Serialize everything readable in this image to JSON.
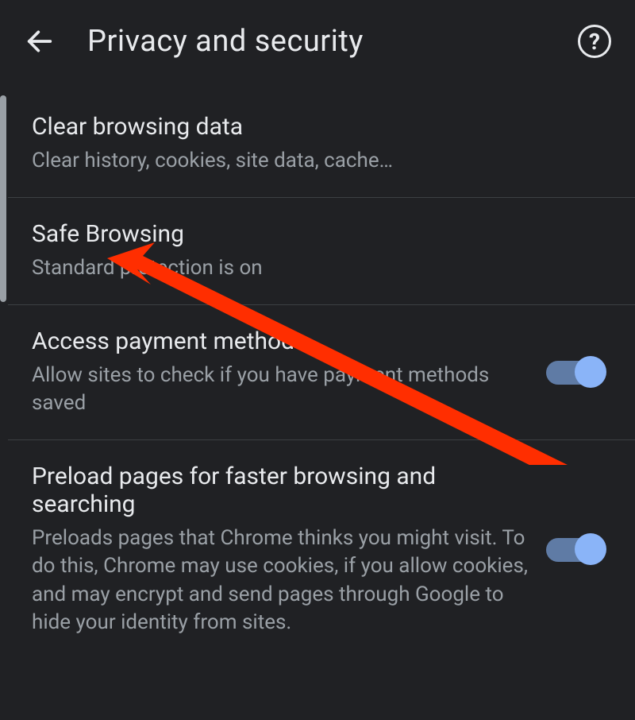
{
  "header": {
    "title": "Privacy and security"
  },
  "items": [
    {
      "title": "Clear browsing data",
      "subtitle": "Clear history, cookies, site data, cache…",
      "toggle": false
    },
    {
      "title": "Safe Browsing",
      "subtitle": "Standard protection is on",
      "toggle": false
    },
    {
      "title": "Access payment methods",
      "subtitle": "Allow sites to check if you have payment methods saved",
      "toggle": true
    },
    {
      "title": "Preload pages for faster browsing and searching",
      "subtitle": "Preloads pages that Chrome thinks you might visit. To do this, Chrome may use cookies, if you allow cookies, and may encrypt and send pages through Google to hide your identity from sites.",
      "toggle": true
    }
  ]
}
